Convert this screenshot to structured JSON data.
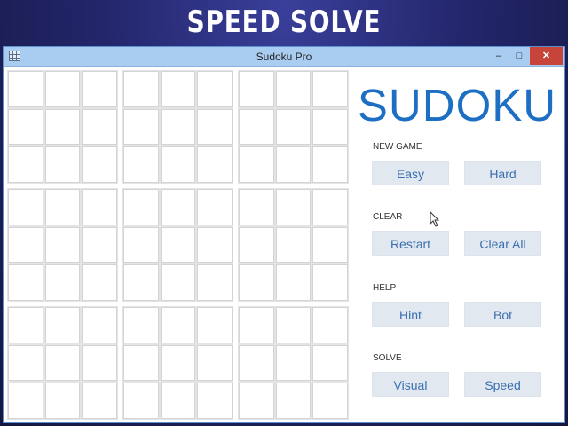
{
  "banner": {
    "title": "SPEED SOLVE"
  },
  "window": {
    "title": "Sudoku Pro",
    "controls": {
      "minimize": "–",
      "maximize": "□",
      "close": "✕"
    }
  },
  "board": {
    "rows": 9,
    "cols": 9,
    "values": []
  },
  "sidebar": {
    "logo": "SUDOKU",
    "sections": {
      "new_game": {
        "label": "NEW GAME",
        "buttons": [
          "Easy",
          "Hard"
        ]
      },
      "clear": {
        "label": "CLEAR",
        "buttons": [
          "Restart",
          "Clear All"
        ]
      },
      "help": {
        "label": "HELP",
        "buttons": [
          "Hint",
          "Bot"
        ]
      },
      "solve": {
        "label": "SOLVE",
        "buttons": [
          "Visual",
          "Speed"
        ]
      }
    }
  },
  "colors": {
    "accent": "#1d6fc4",
    "button_bg": "#e2e8f0",
    "button_text": "#3a6fb0",
    "titlebar": "#a9cdf1",
    "close": "#c7443a"
  }
}
